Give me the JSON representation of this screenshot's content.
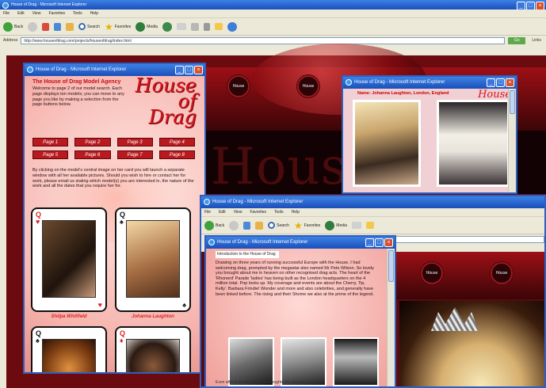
{
  "main_window": {
    "title": "House of Drag - Microsoft Internet Explorer",
    "menu": [
      "File",
      "Edit",
      "View",
      "Favorites",
      "Tools",
      "Help"
    ],
    "toolbar": {
      "back": "Back",
      "search": "Search",
      "favorites": "Favorites",
      "media": "Media"
    },
    "address_label": "Address",
    "address_url": "http://www.houseofdrag.com/projects/houseofdrag/index.html",
    "go": "Go",
    "links": "Links"
  },
  "left_window": {
    "title": "House of Drag - Microsoft Internet Explorer",
    "heading": "The House of Drag Model Agency",
    "intro": "Welcome to page 2 of our model search. Each page displays ten models; you can move to any page you like by making a selection from the page buttons below.",
    "logo": "House of Drag",
    "page_buttons": [
      "Page 1",
      "Page 2",
      "Page 3",
      "Page 4",
      "Page 5",
      "Page 6",
      "Page 7",
      "Page 8"
    ],
    "body": "By clicking on the model's central image on her card you will launch a separate window with all her available pictures. Should you wish to hire or contact her for work, please email us stating which model(s) you are interested in, the nature of the work and all the dates that you require her for.",
    "cards": [
      {
        "rank": "Q",
        "suit": "♥",
        "name": "Shilpa Whitfield"
      },
      {
        "rank": "Q",
        "suit": "♠",
        "name": "Johanna Laughton"
      },
      {
        "rank": "Q",
        "suit": "♠",
        "name": ""
      },
      {
        "rank": "Q",
        "suit": "♦",
        "name": ""
      }
    ]
  },
  "popup_window": {
    "title": "House of Drag - Microsoft Internet Explorer",
    "caption": "Name: Johanna Laughton, London, England",
    "logo": "House"
  },
  "front_window": {
    "title": "House of Drag - Microsoft Internet Explorer",
    "menu": [
      "File",
      "Edit",
      "View",
      "Favorites",
      "Tools",
      "Help"
    ],
    "toolbar": {
      "back": "Back",
      "search": "Search",
      "favorites": "Favorites",
      "media": "Media"
    }
  },
  "inner_window": {
    "title": "House of Drag - Microsoft Internet Explorer",
    "tab_label": "Introduction to the House of Drag",
    "body": "Drawing on three years of running successful Europe with the House, I had welcoming drag, prompted by the megastar also named Mr Pete Wilson. So lovely you brought about me in heaven on other recognised drag acts. The heart of the 'Rhonerd' Parade 'ladies' has being built as the London headquarters on the 4 million total. Pop looks up. My coverage and events are about the Cherry, Tip, Kelly'. Barbara Frindie! Wonder and more and also celebrities, and generally have been linked before. The rising and their Shome we also at the prime of the legend.",
    "footer": "Even after it all ended up, the thoughts tell, my own"
  },
  "brand_logo_text": "House"
}
